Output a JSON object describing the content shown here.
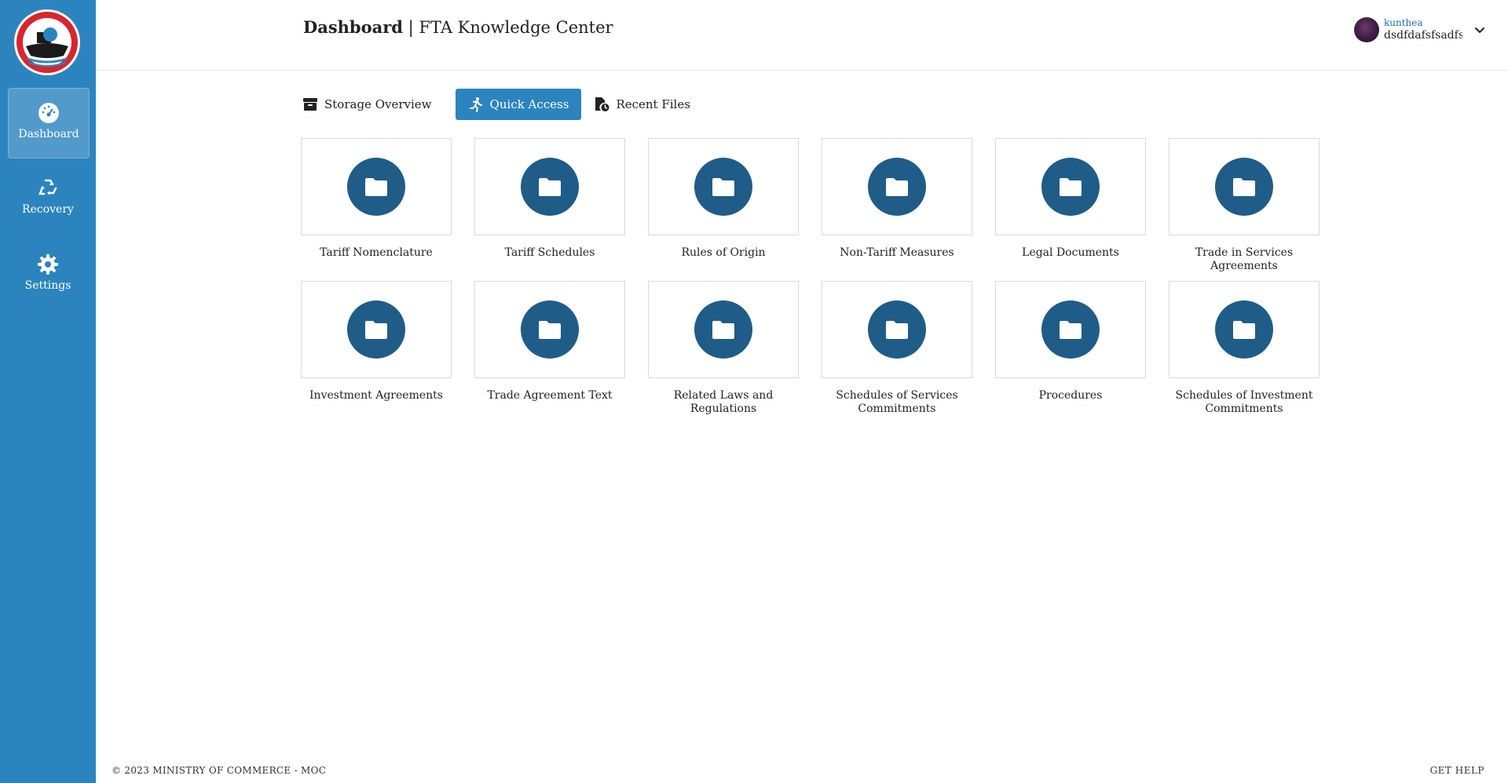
{
  "sidebar": {
    "logo_icon": "moc-emblem-logo",
    "items": [
      {
        "label": "Dashboard",
        "icon": "gauge-icon",
        "active": true
      },
      {
        "label": "Recovery",
        "icon": "recycle-icon",
        "active": false
      },
      {
        "label": "Settings",
        "icon": "gear-icon",
        "active": false
      }
    ]
  },
  "header": {
    "title_bold": "Dashboard",
    "title_separator": " | ",
    "title_rest": "FTA Knowledge Center",
    "user": {
      "name": "kunthea",
      "subtitle": "dsdfdafsfsadfs",
      "menu_icon": "chevron-down-icon"
    }
  },
  "tabs": [
    {
      "label": "Storage Overview",
      "icon": "archive-box-icon",
      "active": false
    },
    {
      "label": "Quick Access",
      "icon": "running-person-icon",
      "active": true
    },
    {
      "label": "Recent Files",
      "icon": "file-clock-icon",
      "active": false
    }
  ],
  "folders": [
    {
      "label": "Tariff Nomenclature"
    },
    {
      "label": "Tariff Schedules"
    },
    {
      "label": "Rules of Origin"
    },
    {
      "label": "Non-Tariff Measures"
    },
    {
      "label": "Legal Documents"
    },
    {
      "label": "Trade in Services Agreements"
    },
    {
      "label": "Investment Agreements"
    },
    {
      "label": "Trade Agreement Text"
    },
    {
      "label": "Related Laws and Regulations"
    },
    {
      "label": "Schedules of Services Commitments"
    },
    {
      "label": "Procedures"
    },
    {
      "label": "Schedules of Investment Commitments"
    }
  ],
  "footer": {
    "copyright": "© 2023 MINISTRY OF COMMERCE - MOC",
    "help": "GET HELP"
  },
  "colors": {
    "sidebar": "#2c84bf",
    "accent": "#2c84bf",
    "folder_circle": "#1f5c88"
  }
}
